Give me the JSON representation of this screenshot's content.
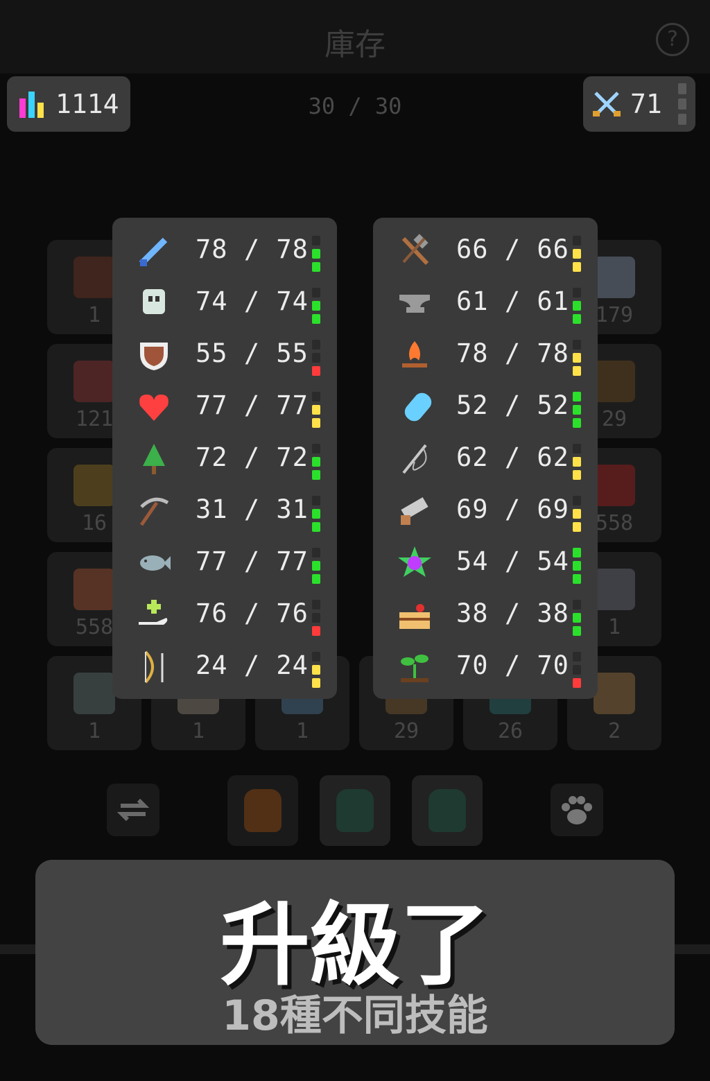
{
  "header": {
    "title": "庫存",
    "help_icon": "?"
  },
  "score": {
    "icon": "bar-chart-icon",
    "value": "1114"
  },
  "capacity": "30 / 30",
  "combat": {
    "icon": "crossed-swords-icon",
    "value": "71"
  },
  "inventory_counts": [
    "1",
    "179",
    "121",
    "29",
    "16",
    "558",
    "558",
    "1",
    "1",
    "1",
    "1",
    "29",
    "26",
    "2"
  ],
  "skills_left": [
    {
      "name": "sword",
      "icon": "sword-icon",
      "text": "78 / 78",
      "color": "#6fb6ff",
      "bar": [
        "#2b2b2b",
        "#2be02b",
        "#2be02b"
      ]
    },
    {
      "name": "defense",
      "icon": "helmet-icon",
      "text": "74 / 74",
      "color": "#d8e8e0",
      "bar": [
        "#2b2b2b",
        "#2be02b",
        "#2be02b"
      ]
    },
    {
      "name": "shield",
      "icon": "shield-icon",
      "text": "55 / 55",
      "color": "#a0553a",
      "bar": [
        "#2b2b2b",
        "#2b2b2b",
        "#ff3b3b"
      ]
    },
    {
      "name": "health",
      "icon": "heart-icon",
      "text": "77 / 77",
      "color": "#ff4040",
      "bar": [
        "#2b2b2b",
        "#ffe14a",
        "#ffe14a"
      ]
    },
    {
      "name": "woodcutting",
      "icon": "tree-icon",
      "text": "72 / 72",
      "color": "#3cb04a",
      "bar": [
        "#2b2b2b",
        "#2be02b",
        "#2be02b"
      ]
    },
    {
      "name": "mining",
      "icon": "pickaxe-icon",
      "text": "31 / 31",
      "color": "#9c5a3a",
      "bar": [
        "#2b2b2b",
        "#2be02b",
        "#2be02b"
      ]
    },
    {
      "name": "fishing",
      "icon": "fish-icon",
      "text": "77 / 77",
      "color": "#9ab0b8",
      "bar": [
        "#2b2b2b",
        "#2be02b",
        "#2be02b"
      ]
    },
    {
      "name": "healing",
      "icon": "healing-hand-icon",
      "text": "76 / 76",
      "color": "#b8e85a",
      "bar": [
        "#2b2b2b",
        "#2b2b2b",
        "#ff3b3b"
      ]
    },
    {
      "name": "archery",
      "icon": "bow-icon",
      "text": "24 / 24",
      "color": "#e0b040",
      "bar": [
        "#2b2b2b",
        "#ffe14a",
        "#ffe14a"
      ]
    }
  ],
  "skills_right": [
    {
      "name": "crafting",
      "icon": "hammer-icon",
      "text": "66 / 66",
      "color": "#b07040",
      "bar": [
        "#2b2b2b",
        "#ffe14a",
        "#ffe14a"
      ]
    },
    {
      "name": "smithing",
      "icon": "anvil-icon",
      "text": "61 / 61",
      "color": "#9a9a9a",
      "bar": [
        "#2b2b2b",
        "#2be02b",
        "#2be02b"
      ]
    },
    {
      "name": "cooking",
      "icon": "campfire-icon",
      "text": "78 / 78",
      "color": "#ff7a30",
      "bar": [
        "#2b2b2b",
        "#ffe14a",
        "#ffe14a"
      ]
    },
    {
      "name": "alchemy",
      "icon": "potion-icon",
      "text": "52 / 52",
      "color": "#6ad0ff",
      "bar": [
        "#2be02b",
        "#2be02b",
        "#2be02b"
      ]
    },
    {
      "name": "tailoring",
      "icon": "needle-icon",
      "text": "62 / 62",
      "color": "#c8c8c8",
      "bar": [
        "#2b2b2b",
        "#ffe14a",
        "#ffe14a"
      ]
    },
    {
      "name": "carpentry",
      "icon": "saw-icon",
      "text": "69 / 69",
      "color": "#c08050",
      "bar": [
        "#2b2b2b",
        "#ffe14a",
        "#ffe14a"
      ]
    },
    {
      "name": "magic",
      "icon": "magic-orb-icon",
      "text": "54 / 54",
      "color": "#c03cff",
      "bar": [
        "#2be02b",
        "#2be02b",
        "#2be02b"
      ]
    },
    {
      "name": "baking",
      "icon": "cake-icon",
      "text": "38 / 38",
      "color": "#f0c070",
      "bar": [
        "#2b2b2b",
        "#2be02b",
        "#2be02b"
      ]
    },
    {
      "name": "farming",
      "icon": "sprout-icon",
      "text": "70 / 70",
      "color": "#40c040",
      "bar": [
        "#2b2b2b",
        "#2b2b2b",
        "#ff3b3b"
      ]
    }
  ],
  "toolbar": {
    "swap_icon": "swap-icon",
    "pet_icon": "paw-icon"
  },
  "banner": {
    "title": "升級了",
    "subtitle": "18種不同技能"
  }
}
